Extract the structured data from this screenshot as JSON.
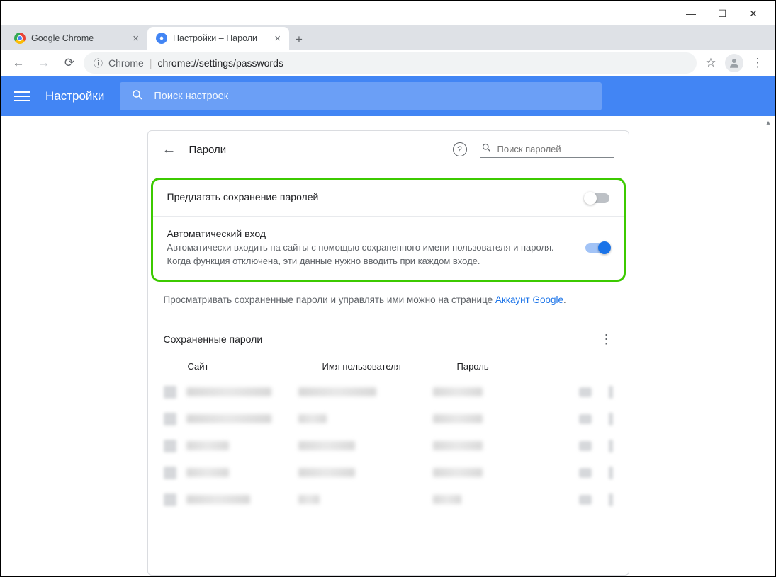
{
  "window": {
    "min": "—",
    "max": "☐",
    "close": "✕"
  },
  "tabs": [
    {
      "title": "Google Chrome"
    },
    {
      "title": "Настройки – Пароли"
    }
  ],
  "omnibox": {
    "scheme": "Chrome",
    "path": "chrome://settings/passwords"
  },
  "settings": {
    "title": "Настройки",
    "search_placeholder": "Поиск настроек"
  },
  "passwords": {
    "back": "←",
    "title": "Пароли",
    "search_placeholder": "Поиск паролей",
    "offer_save": "Предлагать сохранение паролей",
    "auto_signin_title": "Автоматический вход",
    "auto_signin_desc": "Автоматически входить на сайты с помощью сохраненного имени пользователя и пароля. Когда функция отключена, эти данные нужно вводить при каждом входе.",
    "info_text": "Просматривать сохраненные пароли и управлять ими можно на странице ",
    "info_link": "Аккаунт Google",
    "saved_title": "Сохраненные пароли",
    "col_site": "Сайт",
    "col_user": "Имя пользователя",
    "col_pass": "Пароль"
  }
}
